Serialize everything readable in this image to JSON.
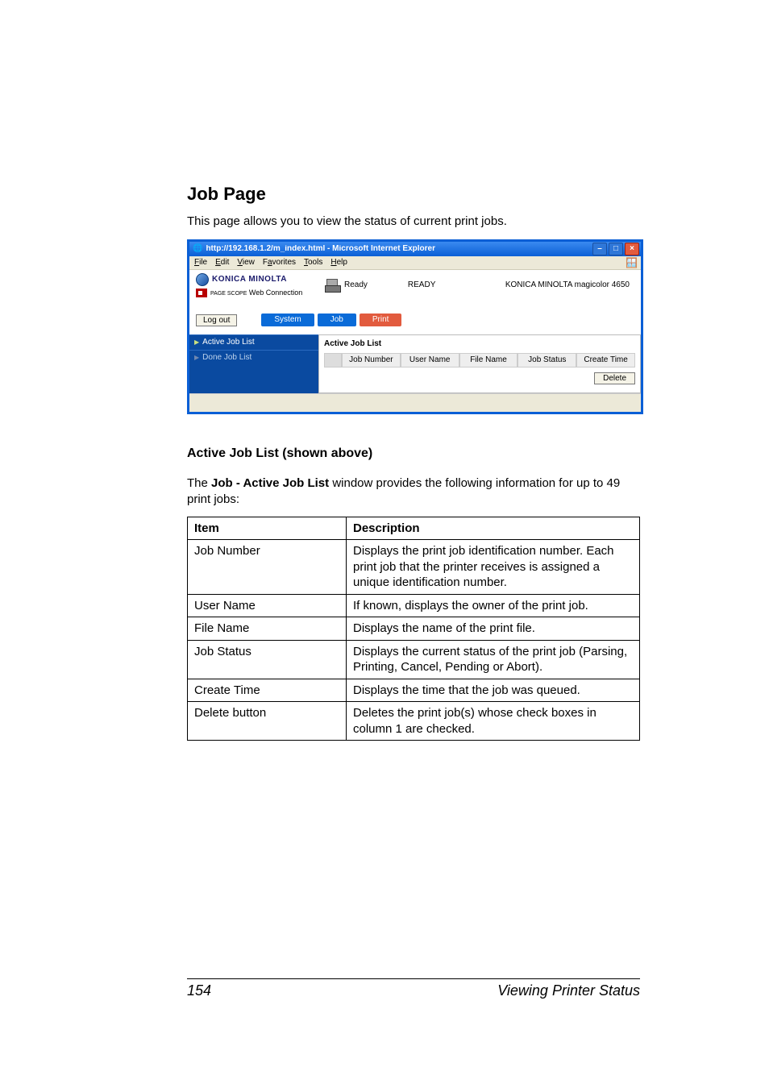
{
  "headings": {
    "job_page": "Job Page",
    "active_list": "Active Job List (shown above)"
  },
  "intro": "This page allows you to view the status of current print jobs.",
  "para_lead": "The ",
  "para_bold": "Job - Active Job List",
  "para_tail": " window provides the following information for up to 49 print jobs:",
  "shot": {
    "title": "http://192.168.1.2/m_index.html - Microsoft Internet Explorer",
    "menu": {
      "file": "File",
      "edit": "Edit",
      "view": "View",
      "fav": "Favorites",
      "tools": "Tools",
      "help": "Help"
    },
    "brand1": "KONICA MINOLTA",
    "brand2a": "PAGE SCOPE",
    "brand2b": " Web Connection",
    "status_ready_icon": "Ready",
    "status_ready_text": "READY",
    "model": "KONICA MINOLTA magicolor 4650",
    "logout": "Log out",
    "tabs": {
      "system": "System",
      "job": "Job",
      "print": "Print"
    },
    "side_active": "Active Job List",
    "side_done": "Done Job List",
    "main_title": "Active Job List",
    "th": {
      "jn": "Job Number",
      "un": "User Name",
      "fn": "File Name",
      "js": "Job Status",
      "ct": "Create Time"
    },
    "delete": "Delete"
  },
  "table": {
    "head": {
      "item": "Item",
      "desc": "Description"
    },
    "rows": [
      {
        "item": "Job Number",
        "desc": "Displays the print job identification number. Each print job that the printer receives is assigned a unique identification number."
      },
      {
        "item": "User Name",
        "desc": "If known, displays the owner of the print job."
      },
      {
        "item": "File Name",
        "desc": "Displays the name of the print file."
      },
      {
        "item": "Job Status",
        "desc": "Displays the current status of the print job (Parsing, Printing, Cancel, Pending or Abort)."
      },
      {
        "item": "Create Time",
        "desc": "Displays the time that the job was queued."
      },
      {
        "item": "Delete button",
        "desc": "Deletes the print job(s) whose check boxes in column 1 are checked."
      }
    ]
  },
  "footer": {
    "page": "154",
    "title": "Viewing Printer Status"
  }
}
